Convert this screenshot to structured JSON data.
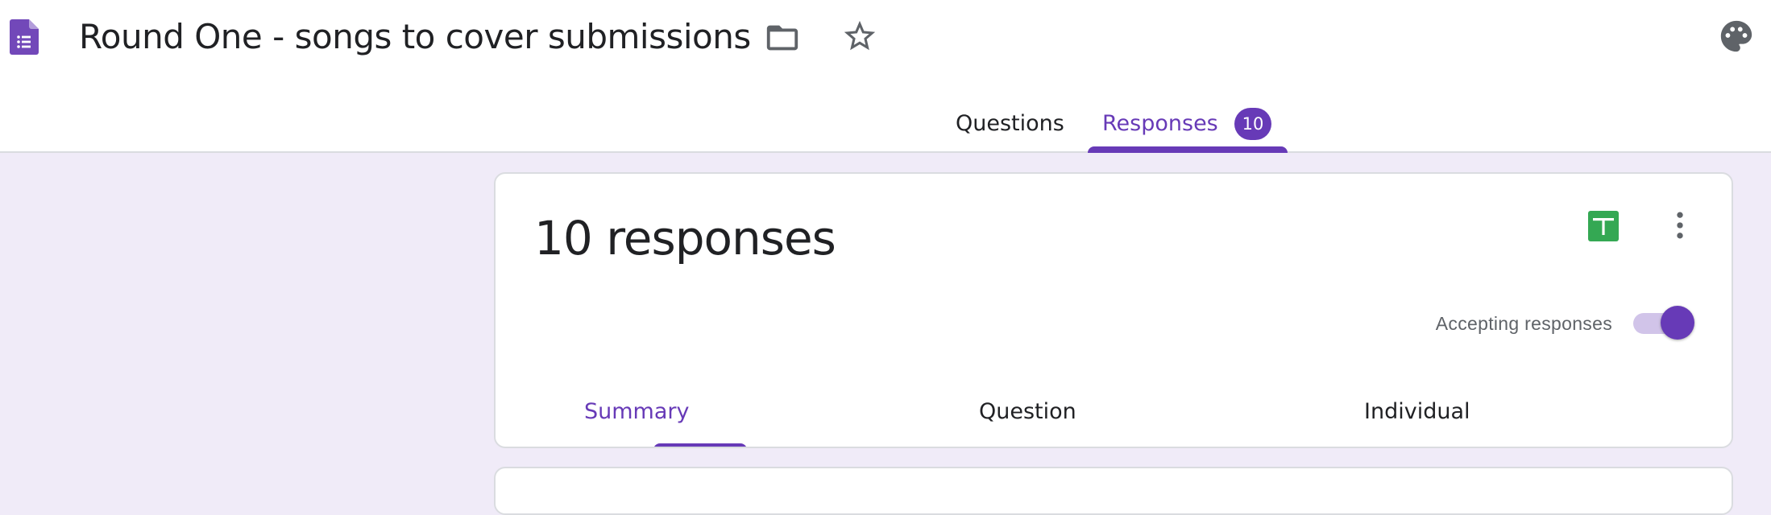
{
  "header": {
    "title": "Round One - songs to cover submissions",
    "icons": [
      "forms-logo-icon",
      "folder-icon",
      "star-icon",
      "palette-icon"
    ]
  },
  "tabs": [
    {
      "label": "Questions",
      "active": false
    },
    {
      "label": "Responses",
      "active": true,
      "badge": "10"
    }
  ],
  "card": {
    "response_count_text": "10 responses",
    "accepting_label": "Accepting responses",
    "accepting_enabled": true,
    "sub_tabs": [
      {
        "label": "Summary",
        "active": true
      },
      {
        "label": "Question",
        "active": false
      },
      {
        "label": "Individual",
        "active": false
      }
    ]
  },
  "colors": {
    "accent": "#673ab7",
    "background": "#f0ebf8",
    "sheets_green": "#34a853"
  }
}
